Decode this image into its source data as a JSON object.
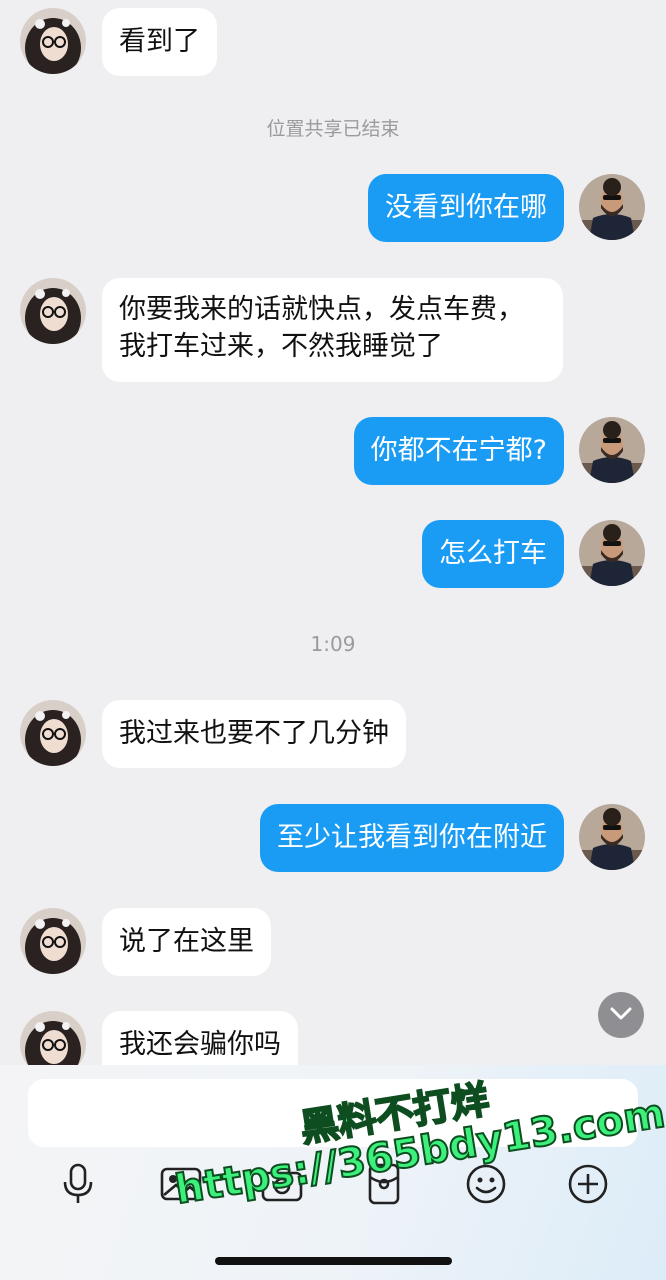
{
  "messages": [
    {
      "side": "in",
      "text": "看到了"
    },
    {
      "side": "out",
      "text": "没看到你在哪"
    },
    {
      "side": "in",
      "lines": [
        "你要我来的话就快点，发点车费，",
        "我打车过来，不然我睡觉了"
      ]
    },
    {
      "side": "out",
      "text": "你都不在宁都?"
    },
    {
      "side": "out",
      "text": "怎么打车"
    },
    {
      "side": "in",
      "text": "我过来也要不了几分钟"
    },
    {
      "side": "out",
      "text": "至少让我看到你在附近"
    },
    {
      "side": "in",
      "text": "说了在这里"
    },
    {
      "side": "in",
      "text": "我还会骗你吗"
    }
  ],
  "system": {
    "location_end": "位置共享已结束",
    "time": "1:09"
  },
  "input": {
    "placeholder": ""
  },
  "toolbar": [
    "microphone-icon",
    "image-icon",
    "camera-icon",
    "red-packet-icon",
    "emoji-icon",
    "plus-icon"
  ],
  "watermark": {
    "line1": "黑料不打烊",
    "line2": "https://365bdy13.com"
  },
  "colors": {
    "outgoing": "#1a9cf5",
    "incoming": "#ffffff",
    "background": "#efeff1",
    "watermark": "#3cf07c"
  }
}
